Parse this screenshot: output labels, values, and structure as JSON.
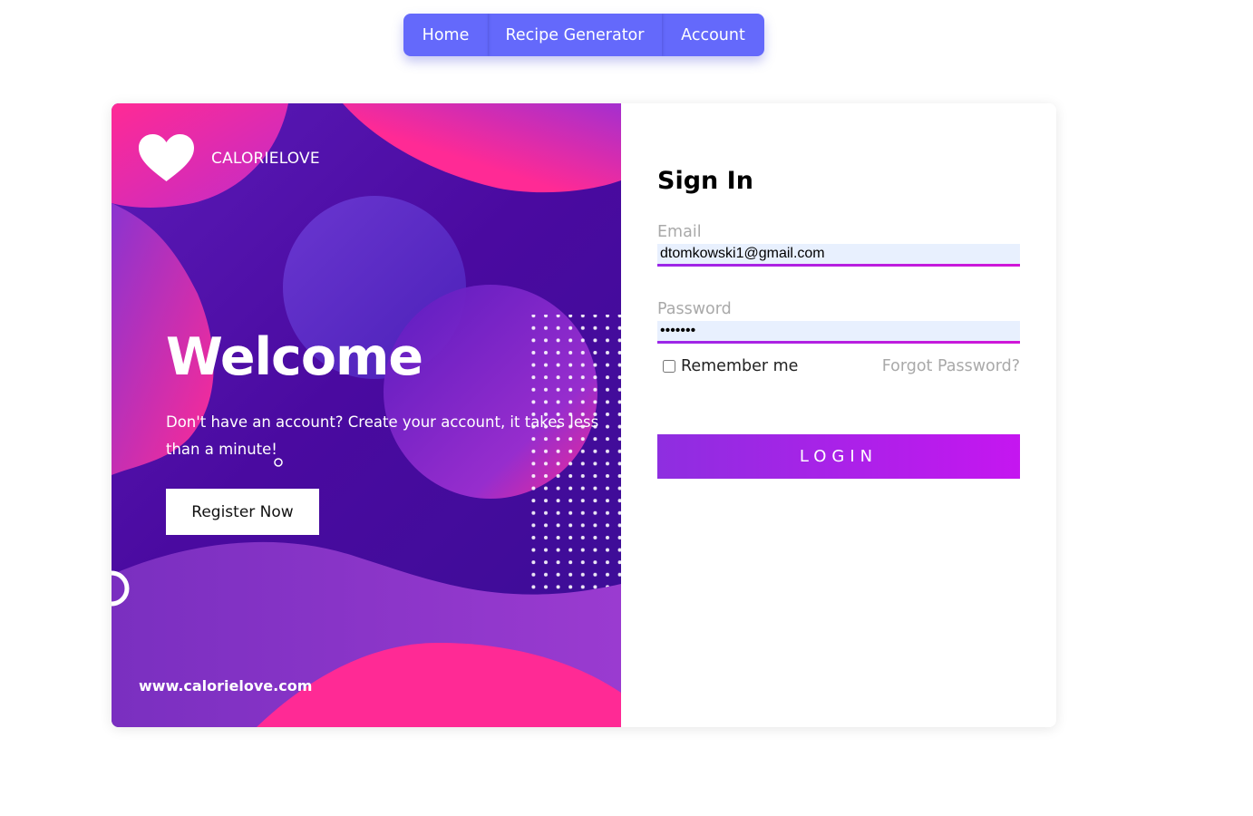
{
  "nav": {
    "items": [
      {
        "label": "Home"
      },
      {
        "label": "Recipe Generator"
      },
      {
        "label": "Account"
      }
    ]
  },
  "promo": {
    "brand_name": "CALORIELOVE",
    "brand_icon": "heart-icon",
    "heading": "Welcome",
    "tagline": "Don't have an account? Create your account, it takes less than a minute!",
    "register_label": "Register Now",
    "site_url": "www.calorielove.com"
  },
  "signin": {
    "title": "Sign In",
    "email_label": "Email",
    "email_value": "dtomkowski1@gmail.com",
    "password_label": "Password",
    "password_value": "•••••••",
    "remember_label": "Remember me",
    "forgot_label": "Forgot Password?",
    "login_label": "LOGIN"
  },
  "colors": {
    "nav_bg": "#6469fb",
    "accent_purple": "#8e2ee0",
    "accent_magenta": "#c516f0",
    "promo_pink": "#ff2a95",
    "promo_violet": "#4a0aa0"
  }
}
